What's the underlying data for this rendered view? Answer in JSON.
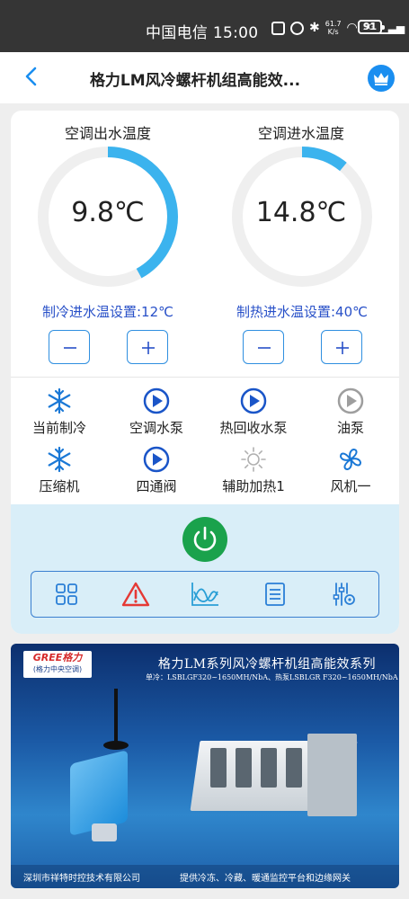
{
  "status_bar": {
    "carrier_time": "中国电信 15:00",
    "net_speed_value": "61.7",
    "net_speed_unit": "K/s",
    "network_type": "5G",
    "battery": "91"
  },
  "header": {
    "title": "格力LM风冷螺杆机组高能效..."
  },
  "gauges": [
    {
      "label": "空调出水温度",
      "value": "9.8℃",
      "fill_fraction": 0.42
    },
    {
      "label": "空调进水温度",
      "value": "14.8℃",
      "fill_fraction": 0.11
    }
  ],
  "settings": [
    {
      "label": "制冷进水温设置:12℃",
      "minus": "−",
      "plus": "+"
    },
    {
      "label": "制热进水温设置:40℃",
      "minus": "−",
      "plus": "+"
    }
  ],
  "status_items": [
    {
      "label": "当前制冷",
      "icon": "snowflake-icon",
      "active": true
    },
    {
      "label": "空调水泵",
      "icon": "play-icon",
      "active": true
    },
    {
      "label": "热回收水泵",
      "icon": "play-icon",
      "active": true
    },
    {
      "label": "油泵",
      "icon": "play-icon",
      "active": false
    },
    {
      "label": "压缩机",
      "icon": "snowflake-icon",
      "active": true
    },
    {
      "label": "四通阀",
      "icon": "play-icon",
      "active": true
    },
    {
      "label": "辅助加热1",
      "icon": "sun-icon",
      "active": false
    },
    {
      "label": "风机一",
      "icon": "fan-icon",
      "active": true
    }
  ],
  "colors": {
    "accent": "#1a8ef0",
    "gauge_fill": "#3bb3ee",
    "gauge_track": "#efefef",
    "setting_text": "#2850c8",
    "power": "#1aa24c",
    "alarm": "#e53935",
    "inactive_icon": "#9e9e9e"
  },
  "toolbar": [
    "grid-icon",
    "alarm-icon",
    "chart-icon",
    "list-icon",
    "settings-sliders-icon"
  ],
  "banner": {
    "brand": "GREE格力",
    "brand_sub": "(格力中央空调)",
    "title": "格力LM系列风冷螺杆机组高能效系列",
    "subtitle": "单冷：LSBLGF320~1650MH/NbA、热泵LSBLGR F320~1650MH/NbA",
    "company": "深圳市祥特时控技术有限公司",
    "slogan": "提供冷冻、冷藏、暖通监控平台和边缘网关"
  }
}
